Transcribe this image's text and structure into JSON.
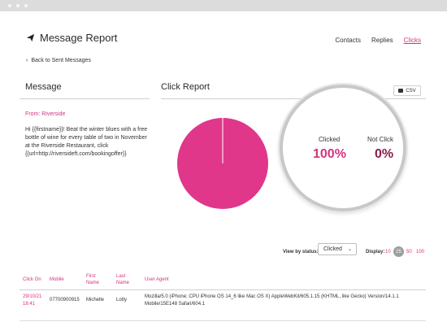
{
  "header": {
    "title": "Message Report",
    "nav": [
      "Contacts",
      "Replies",
      "Clicks"
    ]
  },
  "back_link": "Back to Sent Messages",
  "message": {
    "section_title": "Message",
    "from": "From: Riverside",
    "body": "Hi {{firstname}}! Beat the winter blues with a free bottle of wine for every table of two in November at the Riverside Restaurant, click {{url=http://riversideft.com/bookingoffer}}"
  },
  "click_report": {
    "section_title": "Click Report",
    "csv_label": "CSV",
    "clicked_label": "Clicked",
    "clicked_value": "100%",
    "not_clicked_label": "Not Click",
    "not_clicked_value": "0%"
  },
  "chart_data": {
    "type": "pie",
    "categories": [
      "Clicked",
      "Not Clicked"
    ],
    "values": [
      100,
      0
    ],
    "colors": [
      "#e0378a",
      "#8a1d4d"
    ]
  },
  "filters": {
    "status_label": "View by status:",
    "status_value": "Clicked",
    "display_label": "Display:",
    "page_sizes": [
      "10",
      "25",
      "50",
      "100"
    ],
    "selected_page_size": "25"
  },
  "table": {
    "headers": [
      "Click On",
      "Mobile",
      "First Name",
      "Last Name",
      "User Agent"
    ],
    "rows": [
      {
        "date": "29/10/21 18:41",
        "mobile": "07700900915",
        "first_name": "Michelle",
        "last_name": "Lotty",
        "user_agent": "Mozilla/5.0 (iPhone; CPU iPhone OS 14_6 like Mac OS X) AppleWebKit/605.1.15 (KHTML, like Gecko) Version/14.1.1 Mobile/15E148 Safari/604.1"
      }
    ]
  },
  "colors": {
    "accent": "#d6337f",
    "pie": "#e0378a",
    "not_clicked": "#8a1d4d"
  }
}
